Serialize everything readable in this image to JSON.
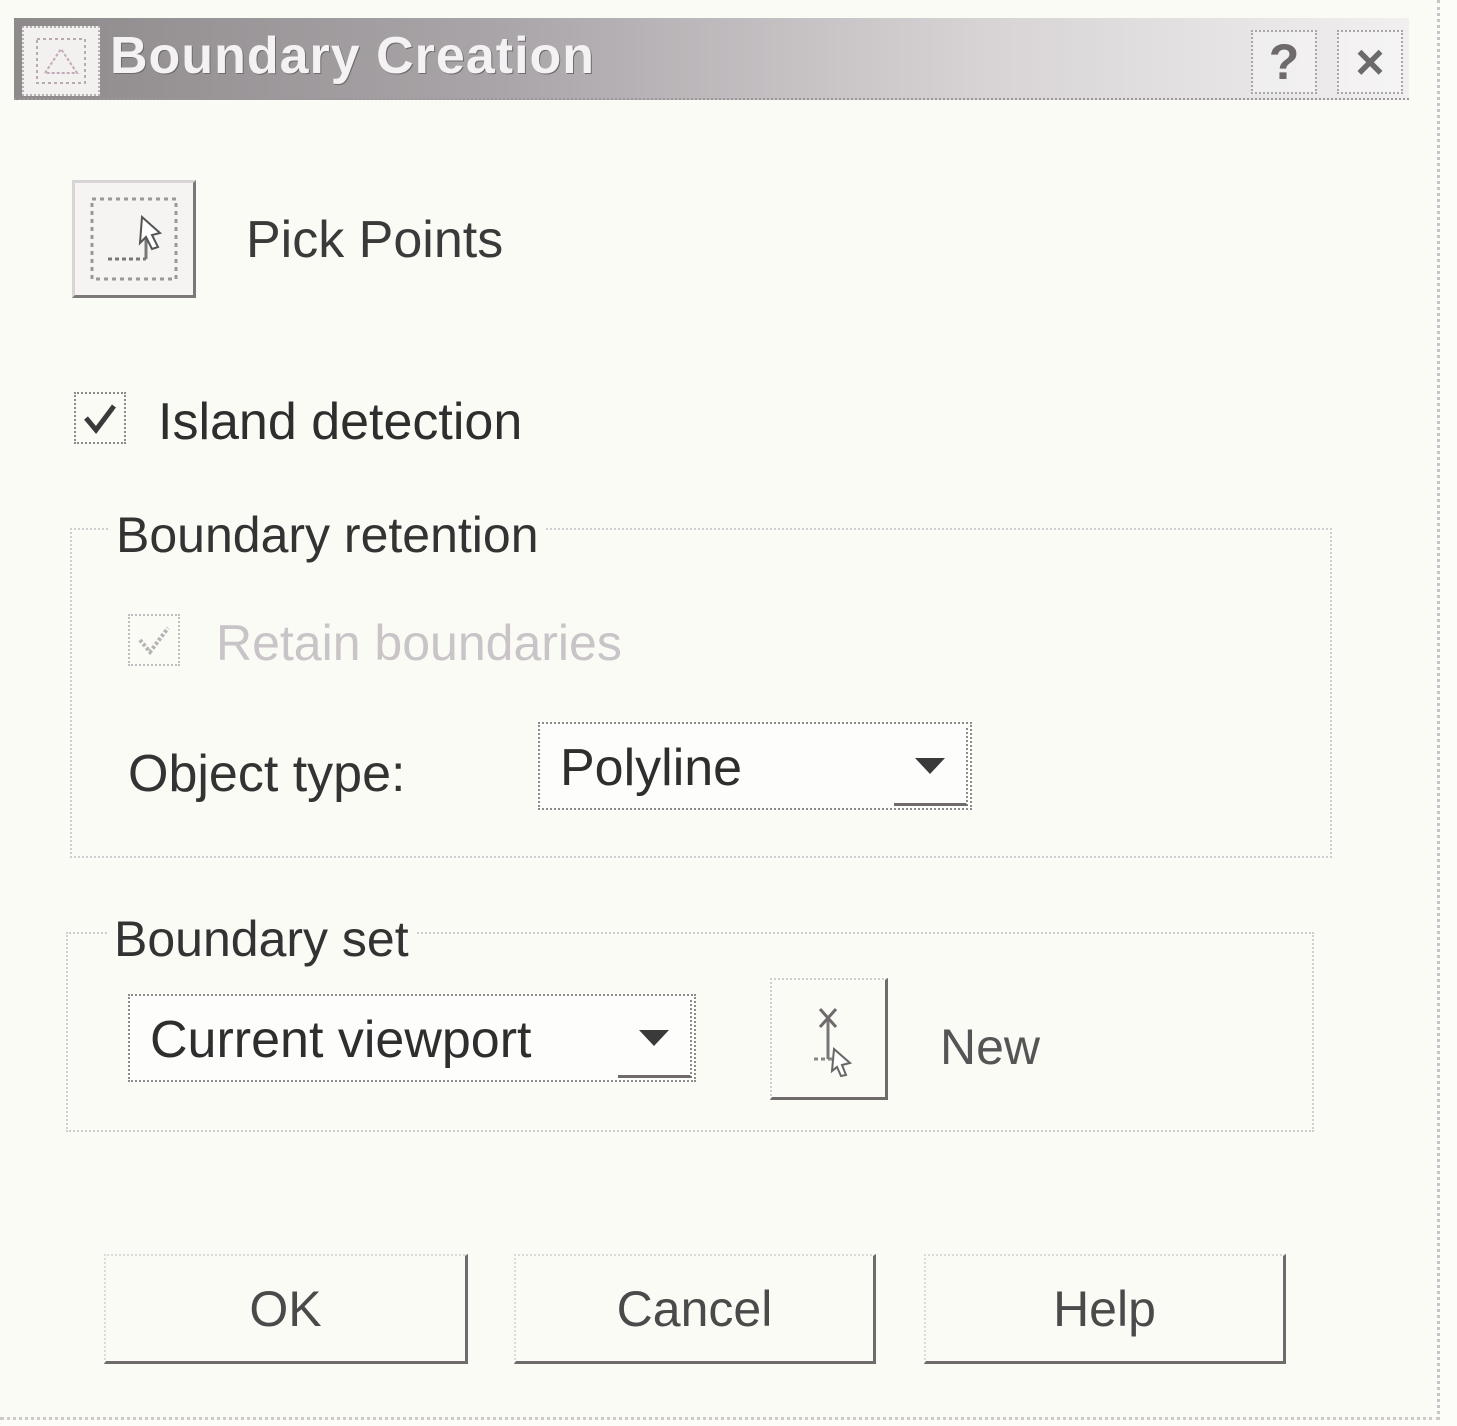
{
  "window": {
    "title": "Boundary Creation",
    "help_button": "?",
    "close_button": "×"
  },
  "pick_points": {
    "label": "Pick Points"
  },
  "island_detection": {
    "label": "Island detection",
    "checked": true
  },
  "boundary_retention": {
    "title": "Boundary retention",
    "retain_label": "Retain boundaries",
    "retain_checked": true,
    "retain_enabled": false,
    "object_type_label": "Object type:",
    "object_type_value": "Polyline"
  },
  "boundary_set": {
    "title": "Boundary set",
    "value": "Current viewport",
    "new_label": "New"
  },
  "buttons": {
    "ok": "OK",
    "cancel": "Cancel",
    "help": "Help"
  },
  "icons": {
    "title": "app-icon",
    "pick_points": "pick-points-icon",
    "check": "checkmark-icon",
    "dropdown": "chevron-down-icon",
    "new_set": "select-objects-icon"
  }
}
